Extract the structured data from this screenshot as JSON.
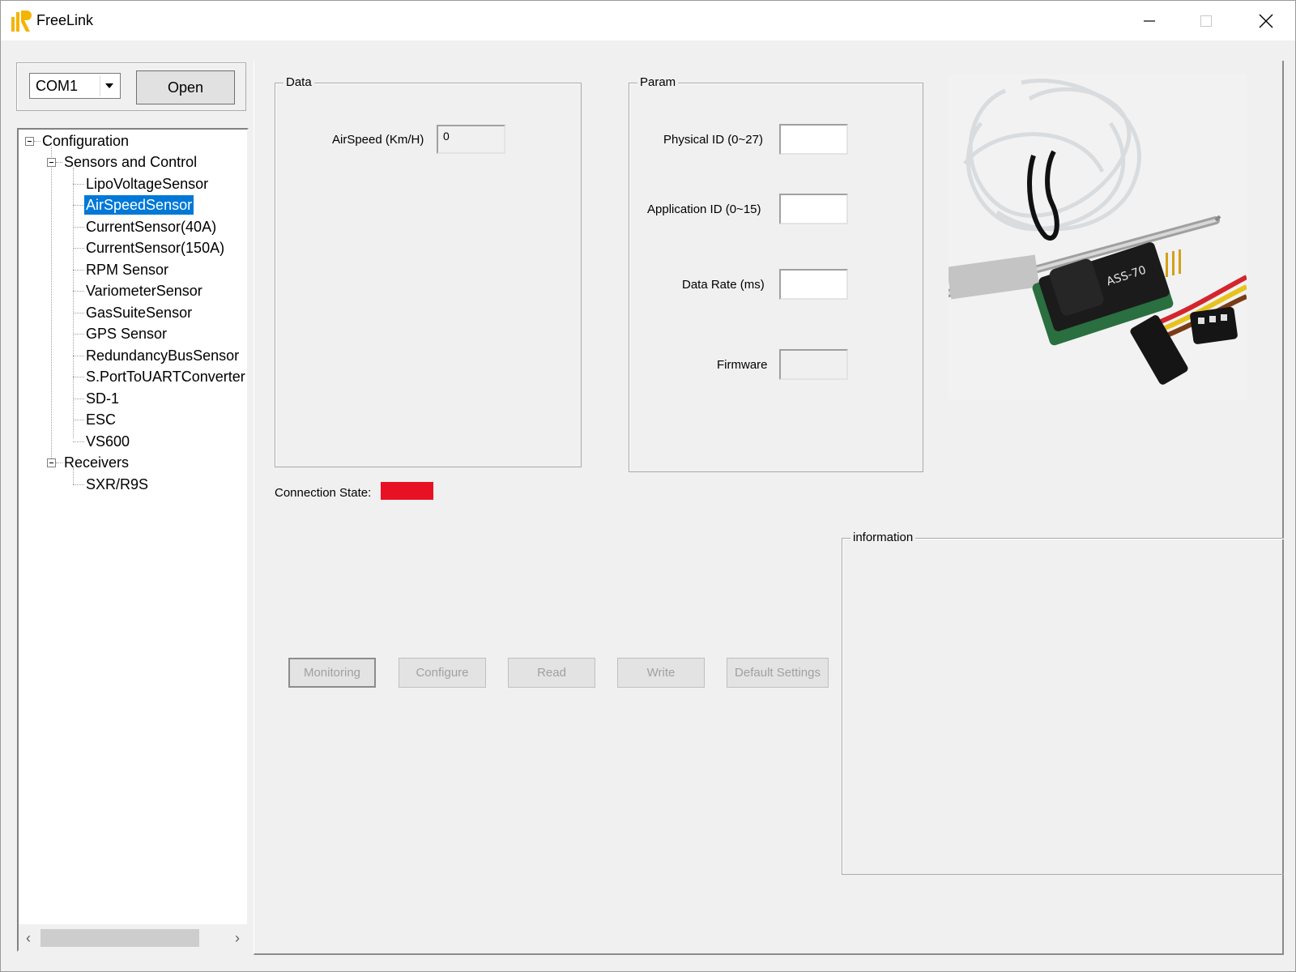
{
  "window": {
    "title": "FreeLink",
    "controls": [
      "minimize",
      "maximize",
      "close"
    ]
  },
  "connection": {
    "port_value": "COM1",
    "open_label": "Open"
  },
  "tree": {
    "root": "Configuration",
    "group1": "Sensors and Control",
    "sensors": [
      "LipoVoltageSensor",
      "AirSpeedSensor",
      "CurrentSensor(40A)",
      "CurrentSensor(150A)",
      "RPM Sensor",
      "VariometerSensor",
      "GasSuiteSensor",
      "GPS Sensor",
      "RedundancyBusSensor",
      "S.PortToUARTConverter",
      "SD-1",
      "ESC",
      "VS600"
    ],
    "selected": "AirSpeedSensor",
    "group2": "Receivers",
    "receivers": [
      "SXR/R9S"
    ]
  },
  "data_group": {
    "title": "Data",
    "airspeed_label": "AirSpeed (Km/H)",
    "airspeed_value": "0"
  },
  "param_group": {
    "title": "Param",
    "physical_id_label": "Physical ID (0~27)",
    "physical_id_value": "",
    "application_id_label": "Application ID (0~15)",
    "application_id_value": "",
    "data_rate_label": "Data Rate (ms)",
    "data_rate_value": "",
    "firmware_label": "Firmware",
    "firmware_value": ""
  },
  "status": {
    "connection_state_label": "Connection State:",
    "connection_state_color": "#e81123"
  },
  "info_group": {
    "title": "information"
  },
  "actions": {
    "monitoring": "Monitoring",
    "configure": "Configure",
    "read": "Read",
    "write": "Write",
    "default_settings": "Default Settings"
  },
  "colors": {
    "selection": "#0078d7",
    "logo": "#f5b400"
  }
}
